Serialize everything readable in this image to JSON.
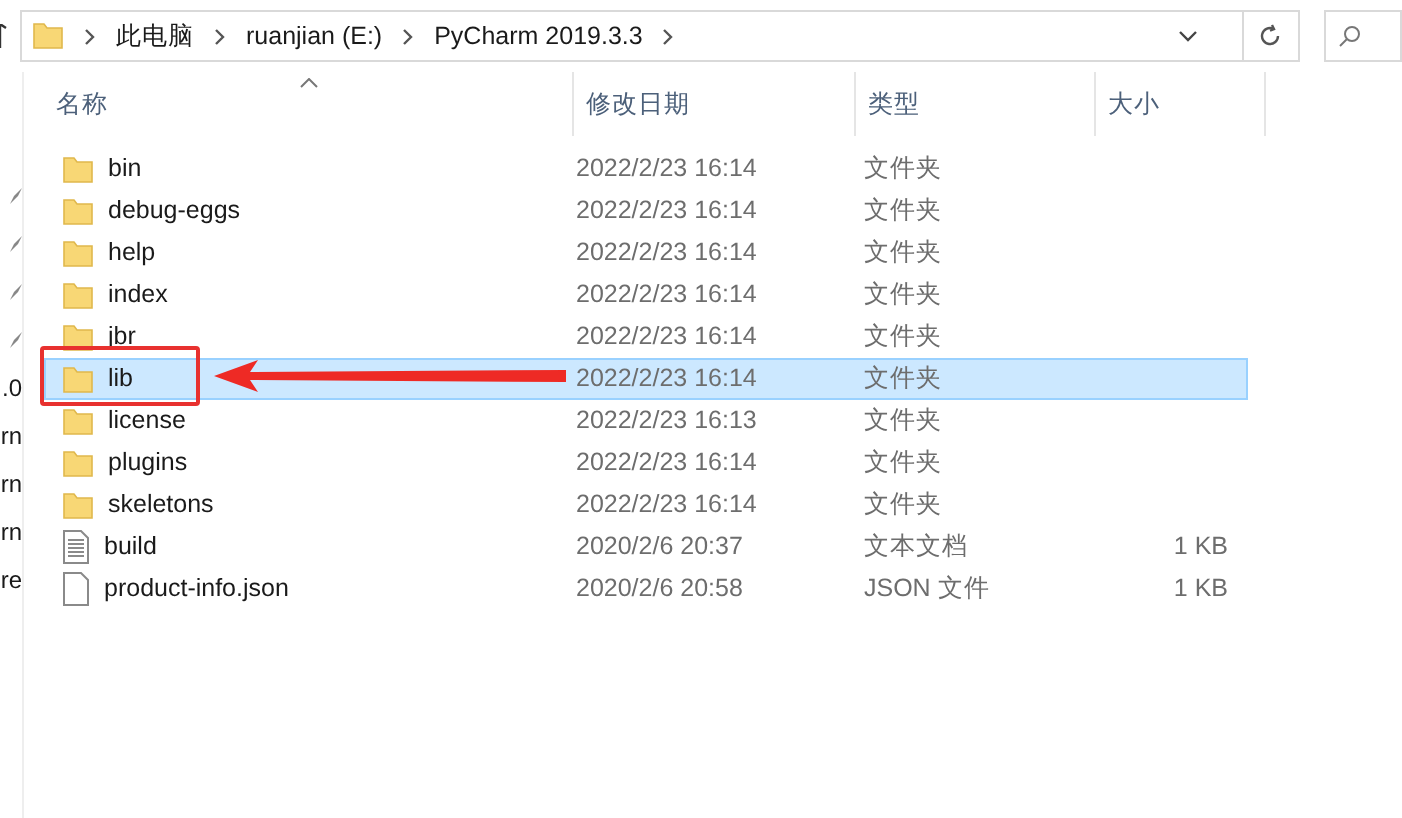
{
  "address_bar": {
    "crumbs": [
      "此电脑",
      "ruanjian (E:)",
      "PyCharm 2019.3.3"
    ]
  },
  "nav_pane": {
    "items": [
      {
        "pinned": true
      },
      {
        "pinned": true
      },
      {
        "pinned": true
      },
      {
        "pinned": true
      },
      {
        "text": ".0",
        "pinned": false
      },
      {
        "text": "rn",
        "pinned": false
      },
      {
        "text": "rn",
        "pinned": false
      },
      {
        "text": "rn",
        "pinned": false
      },
      {
        "text": "re",
        "pinned": false
      }
    ]
  },
  "table": {
    "columns": [
      "名称",
      "修改日期",
      "类型",
      "大小"
    ],
    "rows": [
      {
        "kind": "folder",
        "name": "bin",
        "date": "2022/2/23 16:14",
        "type": "文件夹",
        "selected": false
      },
      {
        "kind": "folder",
        "name": "debug-eggs",
        "date": "2022/2/23 16:14",
        "type": "文件夹",
        "selected": false
      },
      {
        "kind": "folder",
        "name": "help",
        "date": "2022/2/23 16:14",
        "type": "文件夹",
        "selected": false
      },
      {
        "kind": "folder",
        "name": "index",
        "date": "2022/2/23 16:14",
        "type": "文件夹",
        "selected": false
      },
      {
        "kind": "folder",
        "name": "jbr",
        "date": "2022/2/23 16:14",
        "type": "文件夹",
        "selected": false
      },
      {
        "kind": "folder",
        "name": "lib",
        "date": "2022/2/23 16:14",
        "type": "文件夹",
        "selected": true
      },
      {
        "kind": "folder",
        "name": "license",
        "date": "2022/2/23 16:13",
        "type": "文件夹",
        "selected": false
      },
      {
        "kind": "folder",
        "name": "plugins",
        "date": "2022/2/23 16:14",
        "type": "文件夹",
        "selected": false
      },
      {
        "kind": "folder",
        "name": "skeletons",
        "date": "2022/2/23 16:14",
        "type": "文件夹",
        "selected": false
      },
      {
        "kind": "text",
        "name": "build",
        "date": "2020/2/6 20:37",
        "type": "文本文档",
        "size": "1 KB",
        "selected": false
      },
      {
        "kind": "file",
        "name": "product-info.json",
        "date": "2020/2/6 20:58",
        "type": "JSON 文件",
        "size": "1 KB",
        "selected": false
      }
    ]
  }
}
